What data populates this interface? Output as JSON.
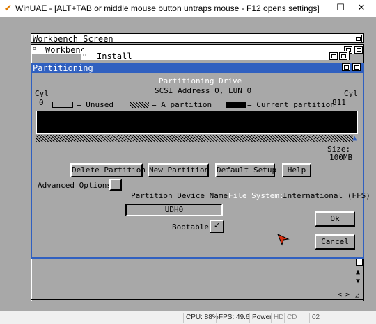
{
  "host": {
    "title": "WinUAE - [ALT+TAB or middle mouse button untraps mouse - F12 opens settings]",
    "minimize": "—",
    "maximize": "☐",
    "close": "✕",
    "status": {
      "cpu": "CPU: 88%",
      "fps": "FPS: 49.6",
      "power": "Power",
      "hd": "HD",
      "cd": "CD",
      "drive": "02"
    }
  },
  "screen": {
    "title": "Workbench Screen",
    "wb_window": "Workbench",
    "install_window": "Install"
  },
  "dialog": {
    "title": "Partitioning",
    "heading": "Partitioning Drive",
    "address": "SCSI Address 0, LUN 0",
    "cyl_left": "Cyl",
    "cyl_left_val": "0",
    "cyl_right": "Cyl",
    "cyl_right_val": "811",
    "legend_unused": "= Unused",
    "legend_partition": "= A partition",
    "legend_current": "= Current partition",
    "size_label": "Size:",
    "size_value": "100MB",
    "buttons": {
      "delete": "Delete Partition",
      "new": "New Partition",
      "default": "Default Setup",
      "help": "Help",
      "ok": "Ok",
      "cancel": "Cancel"
    },
    "advanced_options": "Advanced Options",
    "device_name_label": "Partition Device Name",
    "device_name_value": "UDH0",
    "file_system_label": "File System:",
    "file_system_value": "International (FFS)",
    "bootable_label": "Bootable",
    "bootable_check": "✓"
  },
  "scroll": {
    "up": "▲",
    "down": "▼",
    "left": "<",
    "right": ">"
  }
}
